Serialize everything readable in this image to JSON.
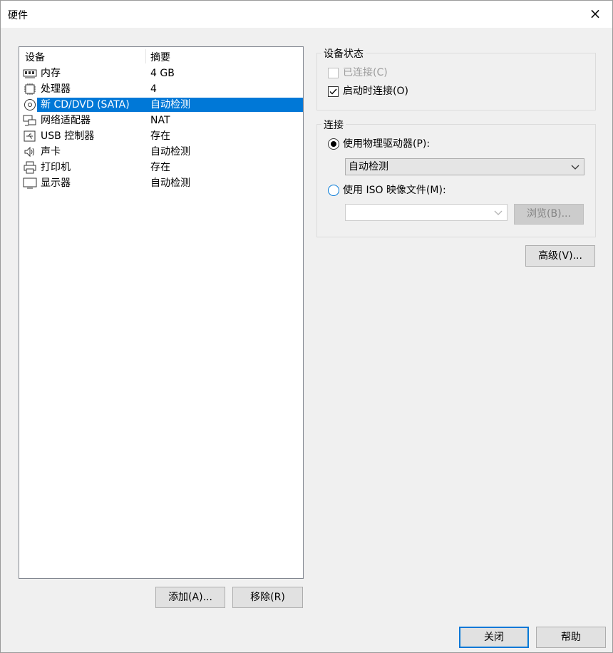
{
  "window": {
    "title": "硬件",
    "close_icon": "×"
  },
  "device_list": {
    "columns": [
      "设备",
      "摘要"
    ],
    "rows": [
      {
        "name": "内存",
        "summary": "4 GB",
        "icon": "memory-icon"
      },
      {
        "name": "处理器",
        "summary": "4",
        "icon": "processor-icon"
      },
      {
        "name": "新 CD/DVD (SATA)",
        "summary": "自动检测",
        "icon": "cd-dvd-icon",
        "selected": true
      },
      {
        "name": "网络适配器",
        "summary": "NAT",
        "icon": "network-adapter-icon"
      },
      {
        "name": "USB 控制器",
        "summary": "存在",
        "icon": "usb-icon"
      },
      {
        "name": "声卡",
        "summary": "自动检测",
        "icon": "speaker-icon"
      },
      {
        "name": "打印机",
        "summary": "存在",
        "icon": "printer-icon"
      },
      {
        "name": "显示器",
        "summary": "自动检测",
        "icon": "monitor-icon"
      }
    ]
  },
  "list_buttons": {
    "add": "添加(A)...",
    "remove": "移除(R)"
  },
  "device_status": {
    "title": "设备状态",
    "connected": {
      "label": "已连接(C)",
      "checked": false,
      "enabled": false
    },
    "connect_at_power_on": {
      "label": "启动时连接(O)",
      "checked": true,
      "enabled": true
    }
  },
  "connection": {
    "title": "连接",
    "physical_drive": {
      "label": "使用物理驱动器(P):",
      "selected": true
    },
    "physical_drive_select": {
      "value": "自动检测"
    },
    "iso_image": {
      "label": "使用 ISO 映像文件(M):",
      "selected": false
    },
    "iso_path": {
      "value": ""
    },
    "browse": "浏览(B)..."
  },
  "advanced": "高级(V)...",
  "footer": {
    "close": "关闭",
    "help": "帮助"
  },
  "colors": {
    "selection": "#0078d7",
    "dialog_bg": "#f0f0f0"
  }
}
